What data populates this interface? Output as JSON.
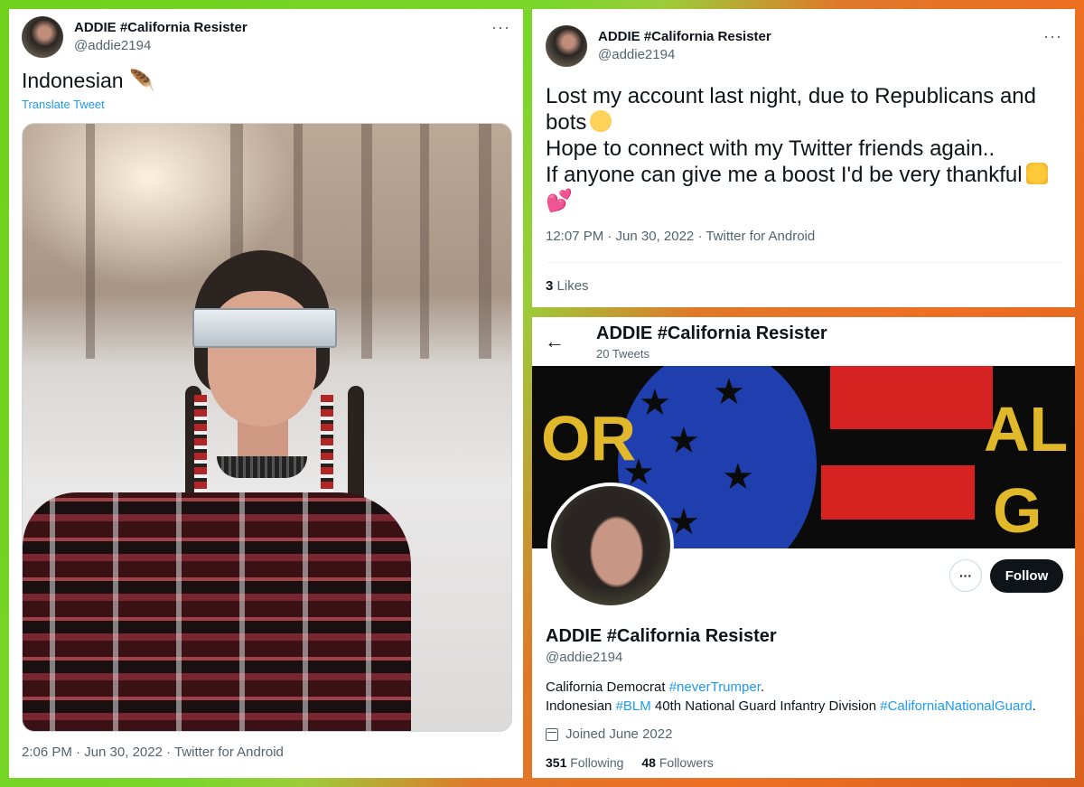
{
  "tweet1": {
    "display_name": "ADDIE #California Resister",
    "handle": "@addie2194",
    "more": "···",
    "text": "Indonesian",
    "text_emoji": "🪶",
    "translate": "Translate Tweet",
    "meta": "2:06 PM · Jun 30, 2022 · Twitter for Android"
  },
  "tweet2": {
    "display_name": "ADDIE #California Resister",
    "handle": "@addie2194",
    "more": "···",
    "lines": [
      "Lost my account last night, due to Republicans and",
      "bots",
      "Hope to connect with my Twitter friends again..",
      "If anyone can give me a boost I'd be very thankful"
    ],
    "hearts": "💕",
    "meta": "12:07 PM · Jun 30, 2022 · Twitter for Android",
    "likes_count": "3",
    "likes_label": "Likes"
  },
  "profile": {
    "header_title": "ADDIE #California Resister",
    "tweet_count": "20 Tweets",
    "back": "←",
    "more": "···",
    "follow": "Follow",
    "name": "ADDIE #California Resister",
    "handle": "@addie2194",
    "bio_line1_text": "California Democrat ",
    "bio_line1_tag": "#neverTrumper",
    "bio_line1_end": ".",
    "bio_line2_text": "Indonesian ",
    "bio_line2_tag1": "#BLM",
    "bio_line2_mid": " 40th National Guard Infantry Division ",
    "bio_line2_tag2": "#CaliforniaNationalGuard",
    "bio_line2_end": ".",
    "joined": "Joined June 2022",
    "following_count": "351",
    "following_label": "Following",
    "followers_count": "48",
    "followers_label": "Followers",
    "banner_text": [
      "OR",
      "AL",
      "G"
    ]
  },
  "colors": {
    "link": "#1d9bf0",
    "muted": "#536471",
    "follow_bg": "#0f1419"
  }
}
